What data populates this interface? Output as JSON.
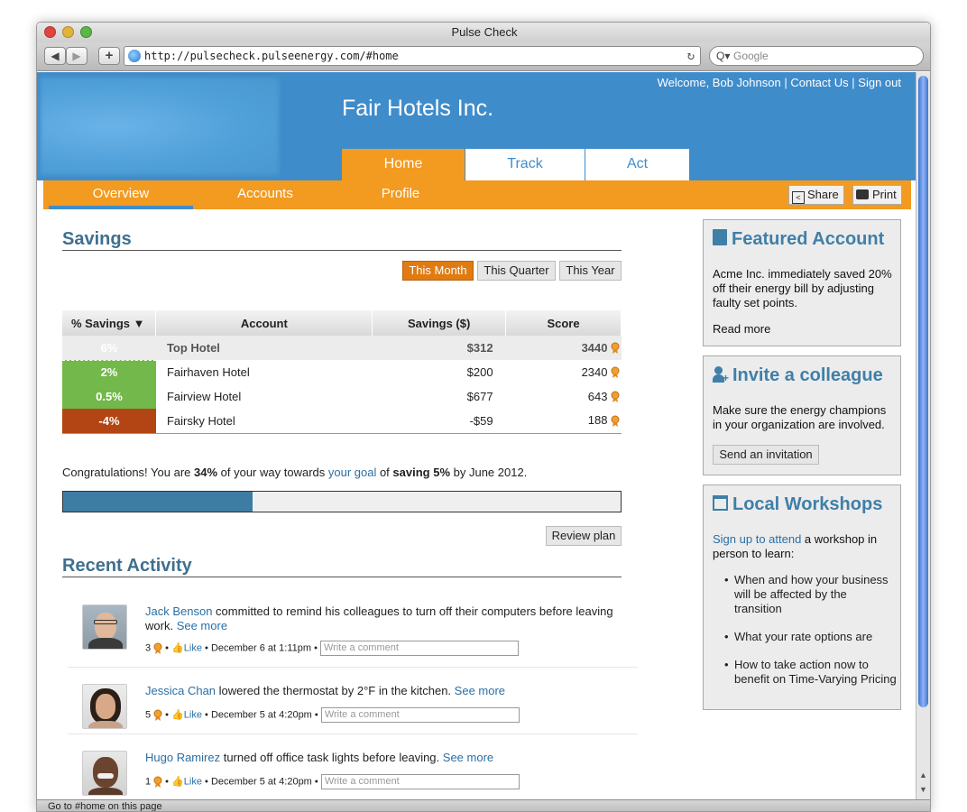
{
  "browser": {
    "window_title": "Pulse Check",
    "url": "http://pulsecheck.pulseenergy.com/#home",
    "search_placeholder": "Google",
    "status": "Go to #home on this page"
  },
  "header": {
    "welcome": "Welcome, Bob Johnson",
    "contact": "Contact Us",
    "signout": "Sign out",
    "separator": "|",
    "company": "Fair Hotels Inc.",
    "main_tabs": [
      "Home",
      "Track",
      "Act"
    ],
    "sub_tabs": [
      "Overview",
      "Accounts",
      "Profile"
    ],
    "share_label": "Share",
    "print_label": "Print"
  },
  "savings": {
    "title": "Savings",
    "periods": [
      "This Month",
      "This Quarter",
      "This Year"
    ],
    "columns": [
      "% Savings ▼",
      "Account",
      "Savings ($)",
      "Score"
    ],
    "rows": [
      {
        "pct": "6%",
        "account": "Top Hotel",
        "savings": "$312",
        "score": "3440"
      },
      {
        "pct": "2%",
        "account": "Fairhaven Hotel",
        "savings": "$200",
        "score": "2340"
      },
      {
        "pct": "0.5%",
        "account": "Fairview Hotel",
        "savings": "$677",
        "score": "643"
      },
      {
        "pct": "-4%",
        "account": "Fairsky Hotel",
        "savings": "-$59",
        "score": "188"
      }
    ],
    "goal_text_1": "Congratulations! You are ",
    "goal_pct": "34%",
    "goal_text_2": " of your way towards ",
    "goal_link": "your goal",
    "goal_text_3": " of ",
    "goal_saving": "saving 5%",
    "goal_text_4": " by June 2012.",
    "progress": 0.34,
    "review_label": "Review plan"
  },
  "activity": {
    "title": "Recent Activity",
    "like_label": "Like",
    "comment_placeholder": "Write a comment",
    "see_more": "See more",
    "items": [
      {
        "name": "Jack Benson",
        "text": " committed to remind his colleagues to turn off their computers before leaving work.",
        "count": "3",
        "date": "December 6 at 1:11pm"
      },
      {
        "name": "Jessica Chan",
        "text": " lowered the thermostat by 2°F in the kitchen.",
        "count": "5",
        "date": "December 5 at 4:20pm"
      },
      {
        "name": "Hugo Ramirez",
        "text": " turned off office task lights before leaving.",
        "count": "1",
        "date": "December 5 at 4:20pm"
      }
    ]
  },
  "sidebar": {
    "featured": {
      "title": "Featured Account",
      "body": "Acme Inc. immediately saved 20% off their energy bill by adjusting faulty set points.",
      "link": "Read more"
    },
    "invite": {
      "title": "Invite a colleague",
      "body": "Make sure the energy champions in your organization are involved.",
      "button": "Send an invitation"
    },
    "workshops": {
      "title": "Local Workshops",
      "link": "Sign up to attend",
      "body": " a workshop in person to learn:",
      "bullets": [
        "When and how your business will be affected by the transition",
        "What your rate options are",
        "How to take action now to benefit on Time-Varying Pricing"
      ]
    }
  },
  "colors": {
    "header_blue": "#3f8ccb",
    "orange": "#f39a20",
    "green": "#72b84a",
    "red": "#b34414",
    "progress": "#3d7da3"
  }
}
